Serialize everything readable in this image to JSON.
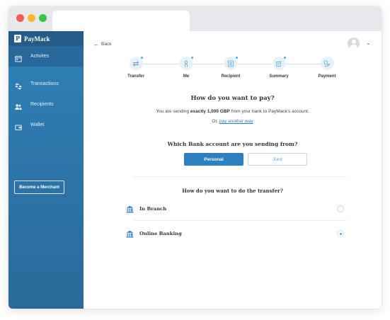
{
  "brand": {
    "name": "PayMack",
    "logo_letter": "P"
  },
  "sidebar": {
    "items": [
      {
        "label": "Activites",
        "icon": "calendar-icon",
        "active": true
      },
      {
        "label": "Transactions",
        "icon": "transactions-icon",
        "active": false
      },
      {
        "label": "Recipients",
        "icon": "users-icon",
        "active": false
      },
      {
        "label": "Wallet",
        "icon": "wallet-icon",
        "active": false
      }
    ],
    "merchant_button": "Become a Merchant"
  },
  "header": {
    "back_label": "Back"
  },
  "steps": [
    {
      "label": "Transfer",
      "icon": "transfer-arrows-icon"
    },
    {
      "label": "Me",
      "icon": "person-icon"
    },
    {
      "label": "Recipient",
      "icon": "recipient-icon"
    },
    {
      "label": "Summary",
      "icon": "summary-icon"
    },
    {
      "label": "Payment",
      "icon": "payment-icon"
    }
  ],
  "payment": {
    "title": "How do you want to pay?",
    "sending_prefix": "You are sending ",
    "sending_amount": "exactly 1,000 GBP",
    "sending_suffix": " from your bank to PayMack's account.",
    "or_prefix": "Or, ",
    "or_link": "pay another way"
  },
  "bank": {
    "title": "Which Bank account are you sending from?",
    "options": [
      "Personal",
      "Joint"
    ],
    "selected": "Personal"
  },
  "transfer": {
    "title": "How do you want to do the transfer?",
    "options": [
      {
        "label": "In Branch",
        "selected": false
      },
      {
        "label": "Online Banking",
        "selected": true
      }
    ]
  },
  "colors": {
    "accent": "#2f7fbf",
    "sidebar": "#2c73a6",
    "brand_bar": "#235d87"
  }
}
